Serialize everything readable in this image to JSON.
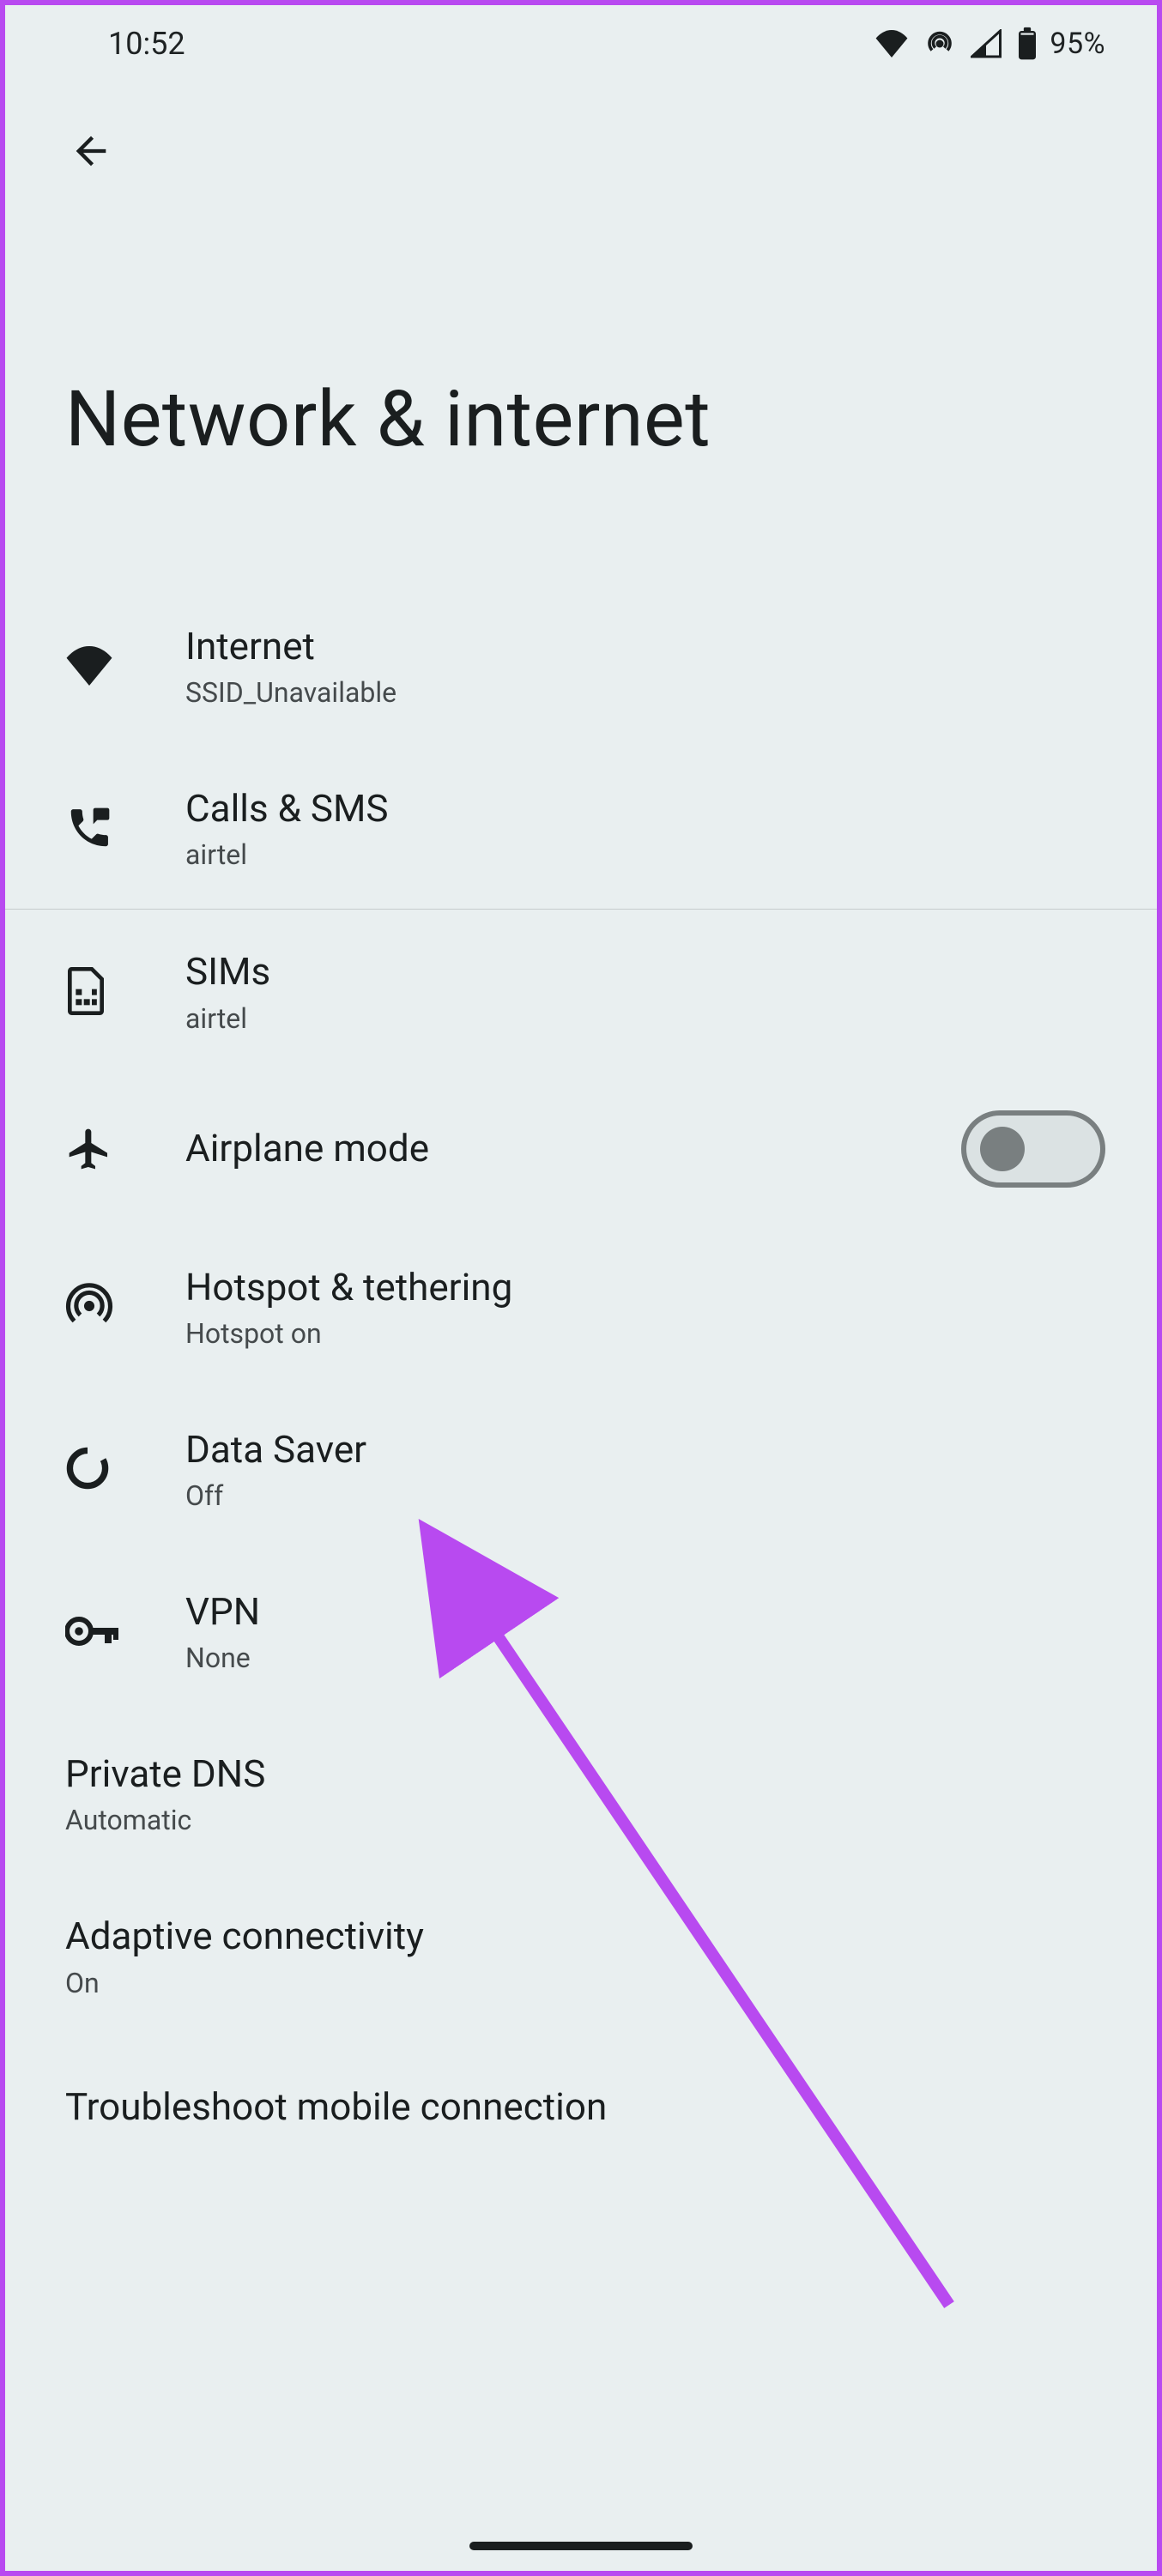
{
  "statusbar": {
    "time": "10:52",
    "battery_pct": "95%"
  },
  "page": {
    "title": "Network & internet"
  },
  "rows": {
    "internet": {
      "title": "Internet",
      "sub": "SSID_Unavailable"
    },
    "calls_sms": {
      "title": "Calls & SMS",
      "sub": "airtel"
    },
    "sims": {
      "title": "SIMs",
      "sub": "airtel"
    },
    "airplane": {
      "title": "Airplane mode"
    },
    "hotspot": {
      "title": "Hotspot & tethering",
      "sub": "Hotspot on"
    },
    "datasaver": {
      "title": "Data Saver",
      "sub": "Off"
    },
    "vpn": {
      "title": "VPN",
      "sub": "None"
    },
    "private_dns": {
      "title": "Private DNS",
      "sub": "Automatic"
    },
    "adaptive": {
      "title": "Adaptive connectivity",
      "sub": "On"
    },
    "troubleshoot": {
      "title": "Troubleshoot mobile connection"
    }
  }
}
